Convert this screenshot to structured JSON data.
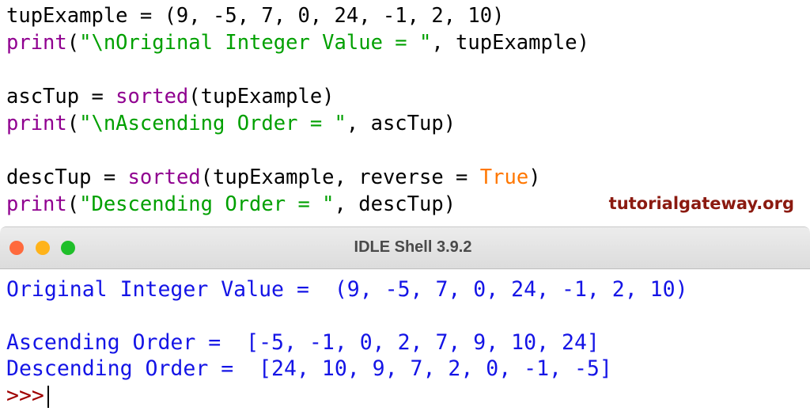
{
  "editor": {
    "lines": [
      [
        {
          "t": "tupExample = (9, -5, 7, 0, 24, -1, 2, 10)",
          "c": ""
        }
      ],
      [
        {
          "t": "print",
          "c": "bi"
        },
        {
          "t": "(",
          "c": ""
        },
        {
          "t": "\"\\nOriginal Integer Value = \"",
          "c": "st"
        },
        {
          "t": ", tupExample)",
          "c": ""
        }
      ],
      [
        {
          "t": "ascTup = ",
          "c": ""
        },
        {
          "t": "sorted",
          "c": "bi"
        },
        {
          "t": "(tupExample)",
          "c": ""
        }
      ],
      [
        {
          "t": "print",
          "c": "bi"
        },
        {
          "t": "(",
          "c": ""
        },
        {
          "t": "\"\\nAscending Order = \"",
          "c": "st"
        },
        {
          "t": ", ascTup)",
          "c": ""
        }
      ],
      [
        {
          "t": "descTup = ",
          "c": ""
        },
        {
          "t": "sorted",
          "c": "bi"
        },
        {
          "t": "(tupExample, reverse = ",
          "c": ""
        },
        {
          "t": "True",
          "c": "kw"
        },
        {
          "t": ")",
          "c": ""
        }
      ],
      [
        {
          "t": "print",
          "c": "bi"
        },
        {
          "t": "(",
          "c": ""
        },
        {
          "t": "\"Descending Order = \"",
          "c": "st"
        },
        {
          "t": ", descTup)",
          "c": ""
        }
      ]
    ],
    "watermark": "tutorialgateway.org"
  },
  "shell": {
    "title": "IDLE Shell 3.9.2",
    "output": [
      "Original Integer Value =  (9, -5, 7, 0, 24, -1, 2, 10)",
      "Ascending Order =  [-5, -1, 0, 2, 7, 9, 10, 24]",
      "Descending Order =  [24, 10, 9, 7, 2, 0, -1, -5]"
    ],
    "prompt": ">>>"
  },
  "colors": {
    "close": "#ff6a3d",
    "minimize": "#ffb31a",
    "zoom": "#1fbf2a",
    "output": "#1414e6",
    "prompt": "#a00000"
  }
}
